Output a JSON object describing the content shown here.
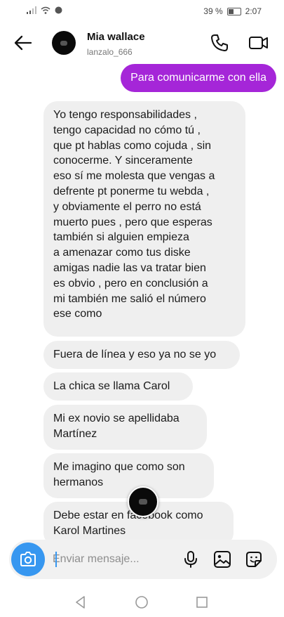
{
  "status": {
    "battery_percent": "39 %",
    "time": "2:07"
  },
  "header": {
    "name": "Mia wallace",
    "username": "lanzalo_666"
  },
  "messages": {
    "outgoing": [
      "Para comunicarme con ella"
    ],
    "incoming": [
      {
        "lines": [
          "Yo tengo responsabilidades ,",
          "tengo capacidad no cómo tú ,",
          "que pt hablas como cojuda , sin",
          "conocerme. Y sinceramente",
          "eso sí me molesta que vengas a",
          "defrente pt ponerme tu webda ,",
          "y obviamente el perro no está",
          "muerto pues , pero que esperas",
          "también si alguien empieza",
          "a amenazar como tus diske",
          "amigas nadie las va tratar bien",
          "es obvio , pero en conclusión a",
          "mi también me salió el número",
          "ese como"
        ]
      },
      {
        "lines": [
          "Fuera de línea y eso ya no se yo"
        ]
      },
      {
        "lines": [
          "La chica se llama Carol"
        ]
      },
      {
        "lines": [
          "Mi ex novio se apellidaba",
          "Martínez"
        ]
      },
      {
        "lines": [
          "Me imagino que como son",
          "hermanos"
        ]
      },
      {
        "lines": [
          "Debe estar en facebook como",
          "Karol Martines"
        ]
      }
    ]
  },
  "composer": {
    "placeholder": "Enviar mensaje..."
  },
  "icons": [
    "back-arrow-icon",
    "phone-icon",
    "video-icon",
    "camera-icon",
    "microphone-icon",
    "gallery-icon",
    "sticker-icon",
    "nav-back-icon",
    "nav-home-icon",
    "nav-recents-icon"
  ],
  "colors": {
    "accent": "#3797f0",
    "outgoing_bubble": "#a526d8",
    "incoming_bubble": "#efefef"
  }
}
